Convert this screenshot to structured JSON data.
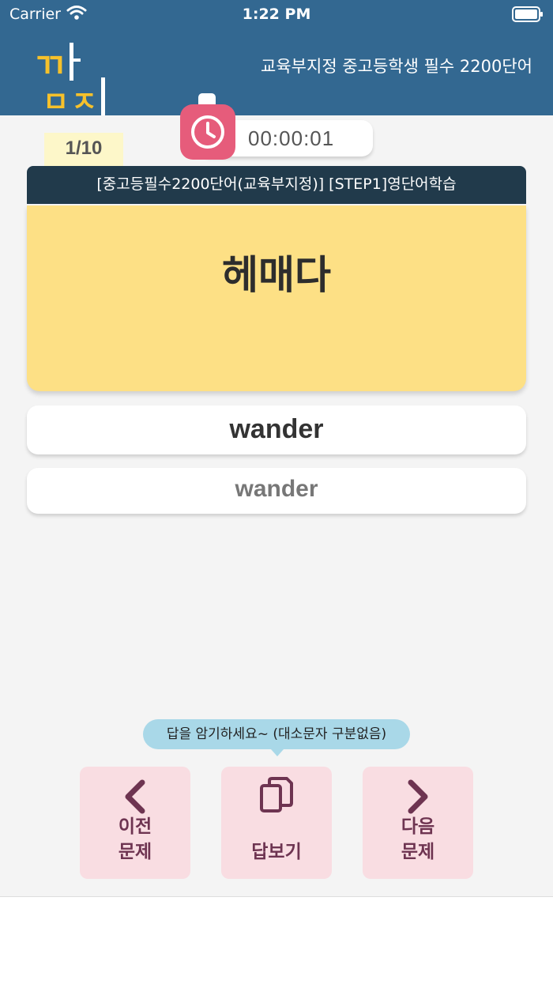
{
  "status": {
    "carrier": "Carrier",
    "time": "1:22 PM"
  },
  "header": {
    "logo_text": "깜지",
    "title": "교육부지정 중고등학생 필수 2200단어"
  },
  "quiz": {
    "counter": "1/10",
    "timer": "00:00:01",
    "category": "[중고등필수2200단어(교육부지정)] [STEP1]영단어학습",
    "question": "헤매다",
    "answer_input": "wander",
    "answer_reveal": "wander"
  },
  "hint": "답을 암기하세요~ (대소문자 구분없음)",
  "actions": {
    "prev": "이전\n문제",
    "show_answer": "답보기",
    "next": "다음\n문제"
  },
  "colors": {
    "header": "#336891",
    "card": "#fde085",
    "category": "#213a4b",
    "timer_icon": "#e65c7b",
    "button_bg": "#f9dde2",
    "button_fg": "#6e3451"
  },
  "icons": {
    "timer": "clock-icon",
    "prev": "chevron-left-icon",
    "copy": "copy-icon",
    "next": "chevron-right-icon"
  }
}
